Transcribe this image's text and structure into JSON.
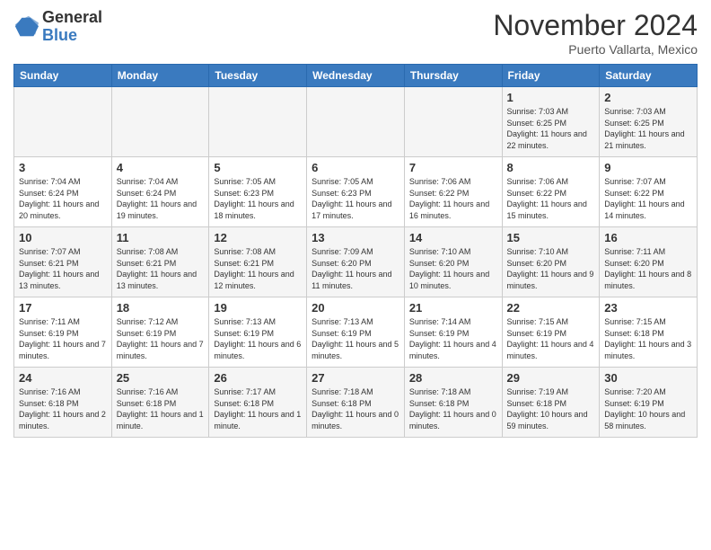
{
  "header": {
    "logo_line1": "General",
    "logo_line2": "Blue",
    "title": "November 2024",
    "location": "Puerto Vallarta, Mexico"
  },
  "weekdays": [
    "Sunday",
    "Monday",
    "Tuesday",
    "Wednesday",
    "Thursday",
    "Friday",
    "Saturday"
  ],
  "weeks": [
    [
      {
        "day": "",
        "info": ""
      },
      {
        "day": "",
        "info": ""
      },
      {
        "day": "",
        "info": ""
      },
      {
        "day": "",
        "info": ""
      },
      {
        "day": "",
        "info": ""
      },
      {
        "day": "1",
        "info": "Sunrise: 7:03 AM\nSunset: 6:25 PM\nDaylight: 11 hours and 22 minutes."
      },
      {
        "day": "2",
        "info": "Sunrise: 7:03 AM\nSunset: 6:25 PM\nDaylight: 11 hours and 21 minutes."
      }
    ],
    [
      {
        "day": "3",
        "info": "Sunrise: 7:04 AM\nSunset: 6:24 PM\nDaylight: 11 hours and 20 minutes."
      },
      {
        "day": "4",
        "info": "Sunrise: 7:04 AM\nSunset: 6:24 PM\nDaylight: 11 hours and 19 minutes."
      },
      {
        "day": "5",
        "info": "Sunrise: 7:05 AM\nSunset: 6:23 PM\nDaylight: 11 hours and 18 minutes."
      },
      {
        "day": "6",
        "info": "Sunrise: 7:05 AM\nSunset: 6:23 PM\nDaylight: 11 hours and 17 minutes."
      },
      {
        "day": "7",
        "info": "Sunrise: 7:06 AM\nSunset: 6:22 PM\nDaylight: 11 hours and 16 minutes."
      },
      {
        "day": "8",
        "info": "Sunrise: 7:06 AM\nSunset: 6:22 PM\nDaylight: 11 hours and 15 minutes."
      },
      {
        "day": "9",
        "info": "Sunrise: 7:07 AM\nSunset: 6:22 PM\nDaylight: 11 hours and 14 minutes."
      }
    ],
    [
      {
        "day": "10",
        "info": "Sunrise: 7:07 AM\nSunset: 6:21 PM\nDaylight: 11 hours and 13 minutes."
      },
      {
        "day": "11",
        "info": "Sunrise: 7:08 AM\nSunset: 6:21 PM\nDaylight: 11 hours and 13 minutes."
      },
      {
        "day": "12",
        "info": "Sunrise: 7:08 AM\nSunset: 6:21 PM\nDaylight: 11 hours and 12 minutes."
      },
      {
        "day": "13",
        "info": "Sunrise: 7:09 AM\nSunset: 6:20 PM\nDaylight: 11 hours and 11 minutes."
      },
      {
        "day": "14",
        "info": "Sunrise: 7:10 AM\nSunset: 6:20 PM\nDaylight: 11 hours and 10 minutes."
      },
      {
        "day": "15",
        "info": "Sunrise: 7:10 AM\nSunset: 6:20 PM\nDaylight: 11 hours and 9 minutes."
      },
      {
        "day": "16",
        "info": "Sunrise: 7:11 AM\nSunset: 6:20 PM\nDaylight: 11 hours and 8 minutes."
      }
    ],
    [
      {
        "day": "17",
        "info": "Sunrise: 7:11 AM\nSunset: 6:19 PM\nDaylight: 11 hours and 7 minutes."
      },
      {
        "day": "18",
        "info": "Sunrise: 7:12 AM\nSunset: 6:19 PM\nDaylight: 11 hours and 7 minutes."
      },
      {
        "day": "19",
        "info": "Sunrise: 7:13 AM\nSunset: 6:19 PM\nDaylight: 11 hours and 6 minutes."
      },
      {
        "day": "20",
        "info": "Sunrise: 7:13 AM\nSunset: 6:19 PM\nDaylight: 11 hours and 5 minutes."
      },
      {
        "day": "21",
        "info": "Sunrise: 7:14 AM\nSunset: 6:19 PM\nDaylight: 11 hours and 4 minutes."
      },
      {
        "day": "22",
        "info": "Sunrise: 7:15 AM\nSunset: 6:19 PM\nDaylight: 11 hours and 4 minutes."
      },
      {
        "day": "23",
        "info": "Sunrise: 7:15 AM\nSunset: 6:18 PM\nDaylight: 11 hours and 3 minutes."
      }
    ],
    [
      {
        "day": "24",
        "info": "Sunrise: 7:16 AM\nSunset: 6:18 PM\nDaylight: 11 hours and 2 minutes."
      },
      {
        "day": "25",
        "info": "Sunrise: 7:16 AM\nSunset: 6:18 PM\nDaylight: 11 hours and 1 minute."
      },
      {
        "day": "26",
        "info": "Sunrise: 7:17 AM\nSunset: 6:18 PM\nDaylight: 11 hours and 1 minute."
      },
      {
        "day": "27",
        "info": "Sunrise: 7:18 AM\nSunset: 6:18 PM\nDaylight: 11 hours and 0 minutes."
      },
      {
        "day": "28",
        "info": "Sunrise: 7:18 AM\nSunset: 6:18 PM\nDaylight: 11 hours and 0 minutes."
      },
      {
        "day": "29",
        "info": "Sunrise: 7:19 AM\nSunset: 6:18 PM\nDaylight: 10 hours and 59 minutes."
      },
      {
        "day": "30",
        "info": "Sunrise: 7:20 AM\nSunset: 6:19 PM\nDaylight: 10 hours and 58 minutes."
      }
    ]
  ]
}
